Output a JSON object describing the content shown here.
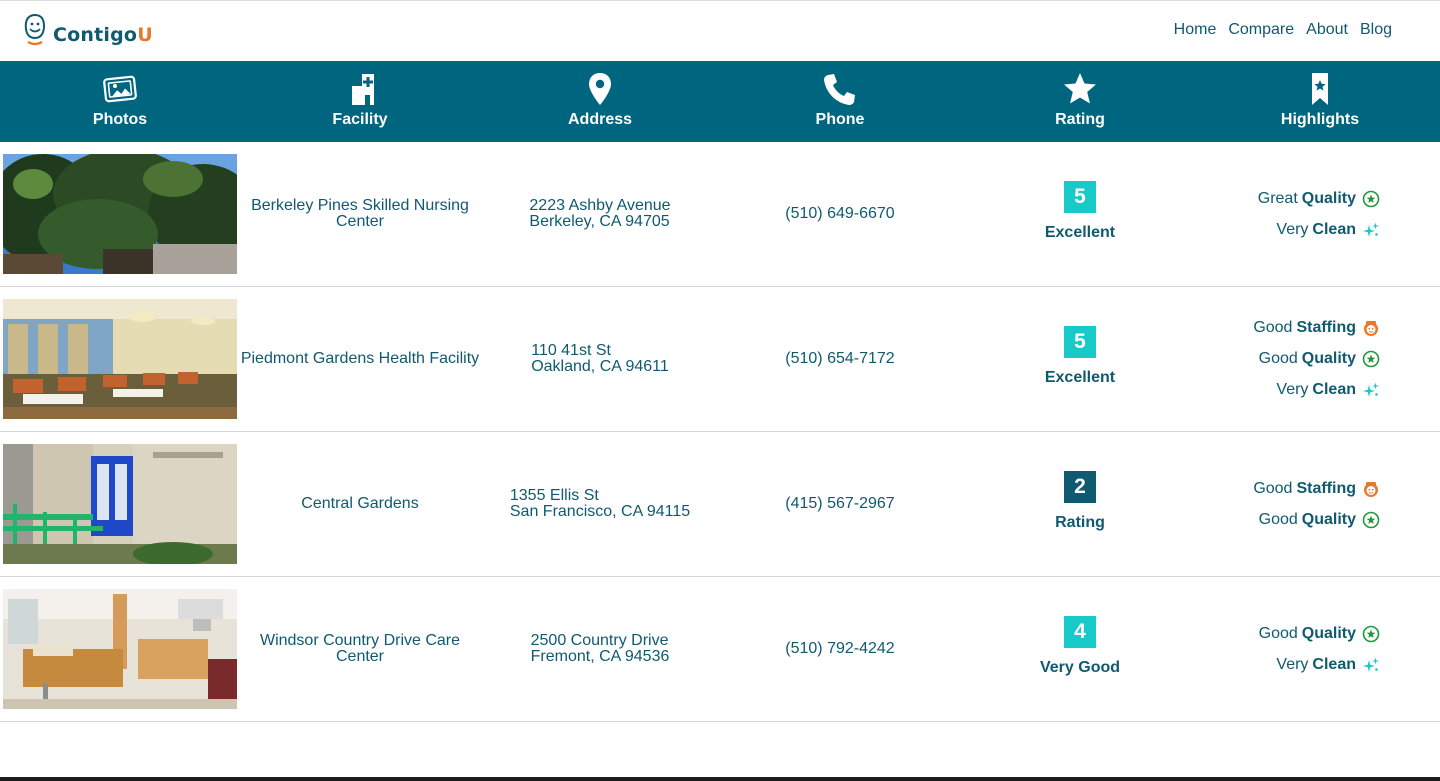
{
  "brand": {
    "name_part1": "Contigo",
    "name_part2": "U"
  },
  "nav": [
    "Home",
    "Compare",
    "About",
    "Blog"
  ],
  "columns": [
    "Photos",
    "Facility",
    "Address",
    "Phone",
    "Rating",
    "Highlights"
  ],
  "colors": {
    "header": "#00657f",
    "text": "#0f5a70",
    "accent_orange": "#e8782a",
    "badge_high": "#17c9c9",
    "badge_low": "#0f5a70",
    "quality_green": "#1f9a3a",
    "clean_teal": "#1cc6c6"
  },
  "facilities": [
    {
      "name": "Berkeley Pines Skilled Nursing Center",
      "address_line1": "2223 Ashby Avenue",
      "address_line2": "Berkeley, CA 94705",
      "phone": "(510) 649-6670",
      "rating": "5",
      "rating_label": "Excellent",
      "badge_color": "#17c9c9",
      "highlights": [
        {
          "word1": "Great",
          "word2": "Quality",
          "icon": "star-circle-icon"
        },
        {
          "word1": "Very",
          "word2": "Clean",
          "icon": "sparkle-icon"
        }
      ]
    },
    {
      "name": "Piedmont Gardens Health Facility",
      "address_line1": "110 41st St",
      "address_line2": "Oakland, CA 94611",
      "phone": "(510) 654-7172",
      "rating": "5",
      "rating_label": "Excellent",
      "badge_color": "#17c9c9",
      "highlights": [
        {
          "word1": "Good",
          "word2": "Staffing",
          "icon": "staff-face-icon"
        },
        {
          "word1": "Good",
          "word2": "Quality",
          "icon": "star-circle-icon"
        },
        {
          "word1": "Very",
          "word2": "Clean",
          "icon": "sparkle-icon"
        }
      ]
    },
    {
      "name": "Central Gardens",
      "address_line1": "1355 Ellis St",
      "address_line2": "San Francisco, CA 94115",
      "phone": "(415) 567-2967",
      "rating": "2",
      "rating_label": "Rating",
      "badge_color": "#0f5a70",
      "highlights": [
        {
          "word1": "Good",
          "word2": "Staffing",
          "icon": "staff-face-icon"
        },
        {
          "word1": "Good",
          "word2": "Quality",
          "icon": "star-circle-icon"
        }
      ]
    },
    {
      "name": "Windsor Country Drive Care Center",
      "address_line1": "2500 Country Drive",
      "address_line2": "Fremont, CA 94536",
      "phone": "(510) 792-4242",
      "rating": "4",
      "rating_label": "Very Good",
      "badge_color": "#17c9c9",
      "highlights": [
        {
          "word1": "Good",
          "word2": "Quality",
          "icon": "star-circle-icon"
        },
        {
          "word1": "Very",
          "word2": "Clean",
          "icon": "sparkle-icon"
        }
      ]
    }
  ]
}
